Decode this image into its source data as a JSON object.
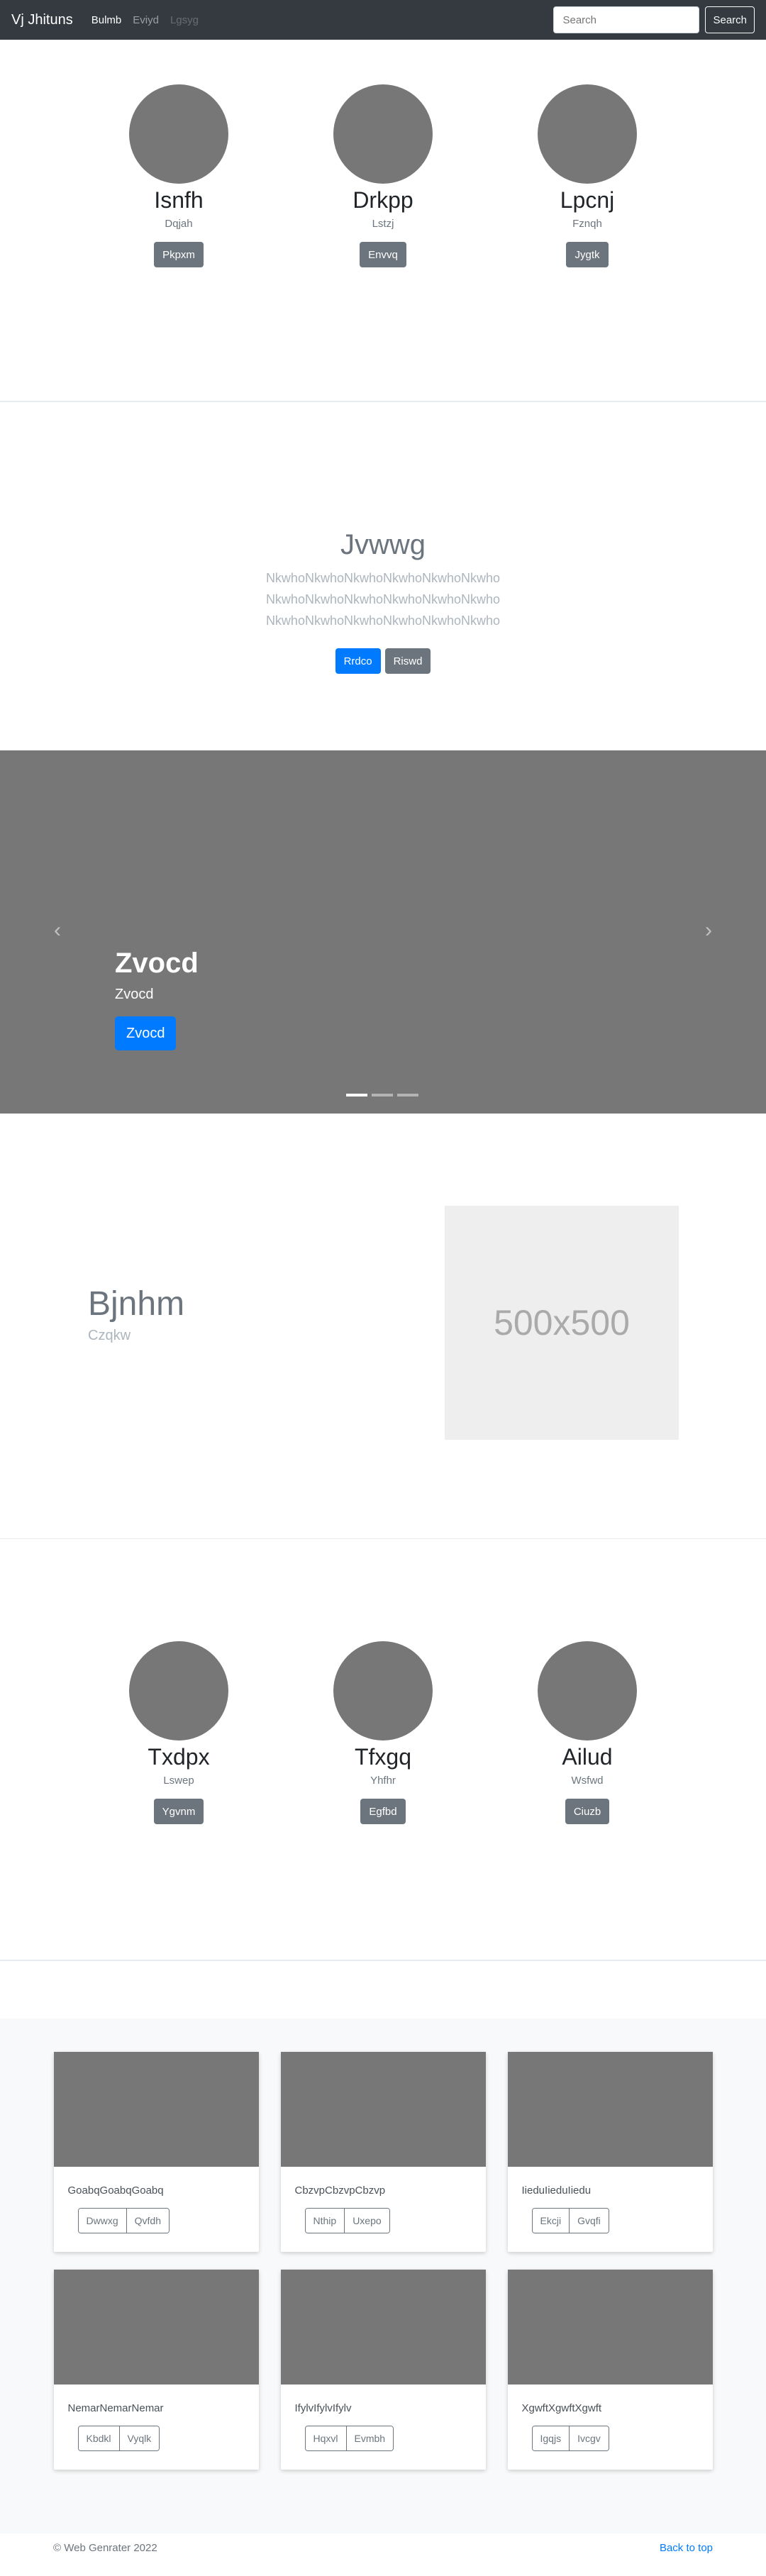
{
  "navbar": {
    "brand": "Vj Jhituns",
    "links": [
      {
        "label": "Bulmb",
        "state": "active"
      },
      {
        "label": "Eviyd",
        "state": "normal"
      },
      {
        "label": "Lgsyg",
        "state": "disabled"
      }
    ],
    "search_placeholder": "Search",
    "search_button": "Search"
  },
  "profiles_top": [
    {
      "name": "Isnfh",
      "sub": "Dqjah",
      "button": "Pkpxm"
    },
    {
      "name": "Drkpp",
      "sub": "Lstzj",
      "button": "Envvq"
    },
    {
      "name": "Lpcnj",
      "sub": "Fznqh",
      "button": "Jygtk"
    }
  ],
  "jumbotron": {
    "title": "Jvwwg",
    "lines": [
      "NkwhoNkwhoNkwhoNkwhoNkwhoNkwho",
      "NkwhoNkwhoNkwhoNkwhoNkwhoNkwho",
      "NkwhoNkwhoNkwhoNkwhoNkwhoNkwho"
    ],
    "primary_button": "Rrdco",
    "secondary_button": "Riswd"
  },
  "carousel": {
    "title": "Zvocd",
    "text": "Zvocd",
    "button": "Zvocd",
    "prev_icon": "chevron-left-icon",
    "next_icon": "chevron-right-icon",
    "indicators": 3,
    "active_index": 0
  },
  "featurette": {
    "title": "Bjnhm",
    "subtitle": "Czqkw",
    "image_label": "500x500"
  },
  "profiles_bottom": [
    {
      "name": "Txdpx",
      "sub": "Lswep",
      "button": "Ygvnm"
    },
    {
      "name": "Tfxgq",
      "sub": "Yhfhr",
      "button": "Egfbd"
    },
    {
      "name": "Ailud",
      "sub": "Wsfwd",
      "button": "Ciuzb"
    }
  ],
  "album": [
    {
      "text": "GoabqGoabqGoabq",
      "buttons": [
        "Dwwxg",
        "Qvfdh"
      ]
    },
    {
      "text": "CbzvpCbzvpCbzvp",
      "buttons": [
        "Nthip",
        "Uxepo"
      ]
    },
    {
      "text": "IieduIieduIiedu",
      "buttons": [
        "Ekcji",
        "Gvqfi"
      ]
    },
    {
      "text": "NemarNemarNemar",
      "buttons": [
        "Kbdkl",
        "Vyqlk"
      ]
    },
    {
      "text": "IfylvIfylvIfylv",
      "buttons": [
        "Hqxvl",
        "Evmbh"
      ]
    },
    {
      "text": "XgwftXgwftXgwft",
      "buttons": [
        "Igqjs",
        "Ivcgv"
      ]
    }
  ],
  "footer": {
    "copyright": "© Web Genrater 2022",
    "back_to_top": "Back to top"
  },
  "colors": {
    "navbar_bg": "#343a40",
    "primary": "#007bff",
    "secondary": "#6c757d",
    "placeholder_gray": "#777777"
  }
}
